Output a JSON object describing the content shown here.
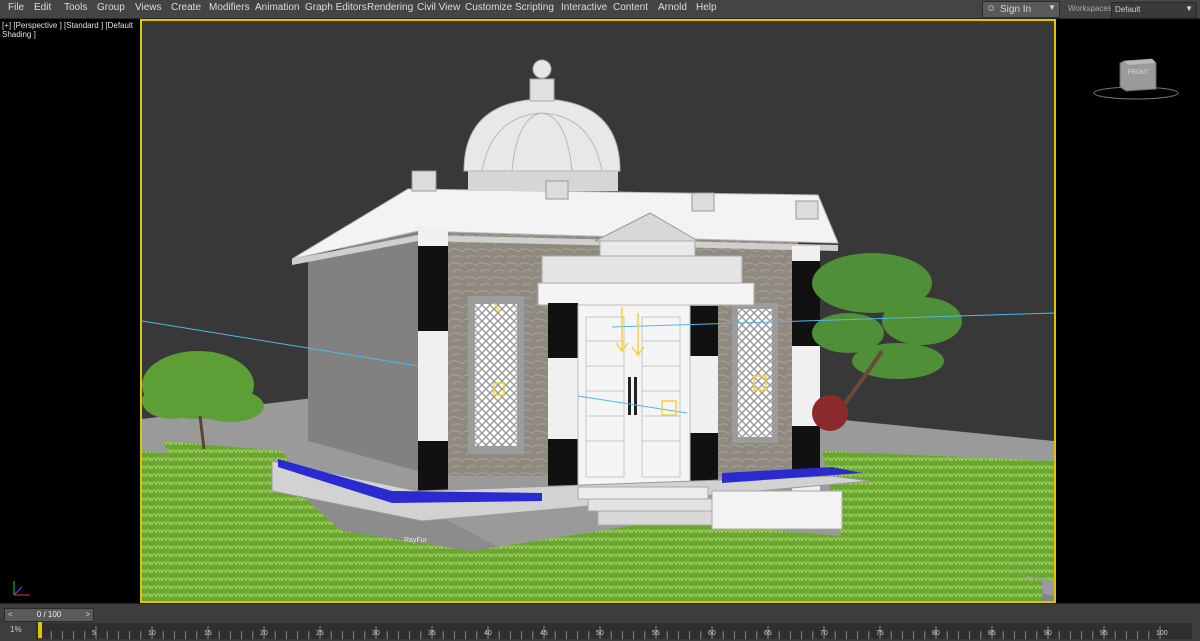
{
  "menu": [
    "File",
    "Edit",
    "Tools",
    "Group",
    "Views",
    "Create",
    "Modifiers",
    "Animation",
    "Graph Editors",
    "Rendering",
    "Civil View",
    "Customize",
    "Scripting",
    "Interactive",
    "Content",
    "Arnold",
    "Help"
  ],
  "signin": {
    "label": "Sign In"
  },
  "workspaces": {
    "label": "Workspaces:",
    "value": "Default"
  },
  "viewport": {
    "label": "[+] [Perspective ] [Standard ] [Default Shading ]",
    "object_label": "RayFur"
  },
  "viewcube": {
    "face": "FRONT"
  },
  "timeline": {
    "frame": "0 / 100",
    "percent": "1%",
    "ticks": [
      "5",
      "10",
      "15",
      "20",
      "25",
      "30",
      "35",
      "40",
      "45",
      "50",
      "55",
      "60",
      "65",
      "70",
      "75",
      "80",
      "85",
      "90",
      "95",
      "100"
    ]
  },
  "colors": {
    "active_border": "#e1c300",
    "menu_bg": "#444444",
    "viewport_bg": "#383838"
  }
}
